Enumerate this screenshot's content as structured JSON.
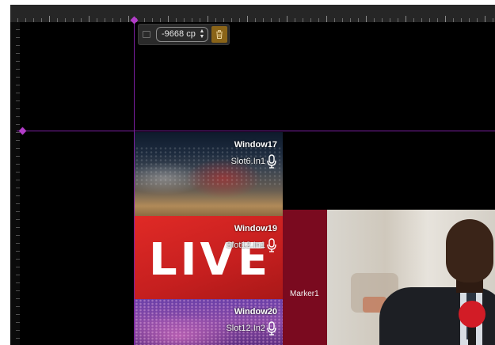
{
  "toolbar": {
    "offset_value": "-9668 cp",
    "icons": [
      "frame-icon",
      "stepper-icon",
      "trash-icon"
    ]
  },
  "tiles": [
    {
      "title": "Window17",
      "slot": "Slot6.In1",
      "icon": "microphone-icon"
    },
    {
      "title": "Window19",
      "slot": "Slot12.In1",
      "overlay": "LIVE",
      "icon": "microphone-icon"
    },
    {
      "title": "Window20",
      "slot": "Slot12.In2",
      "icon": "microphone-icon"
    }
  ],
  "marker": {
    "label": "Marker1"
  },
  "colors": {
    "guide": "#7a1ea0",
    "marker_bg": "#7a0a1f",
    "live_red": "#e02a26",
    "delete_button": "#8a6418"
  }
}
